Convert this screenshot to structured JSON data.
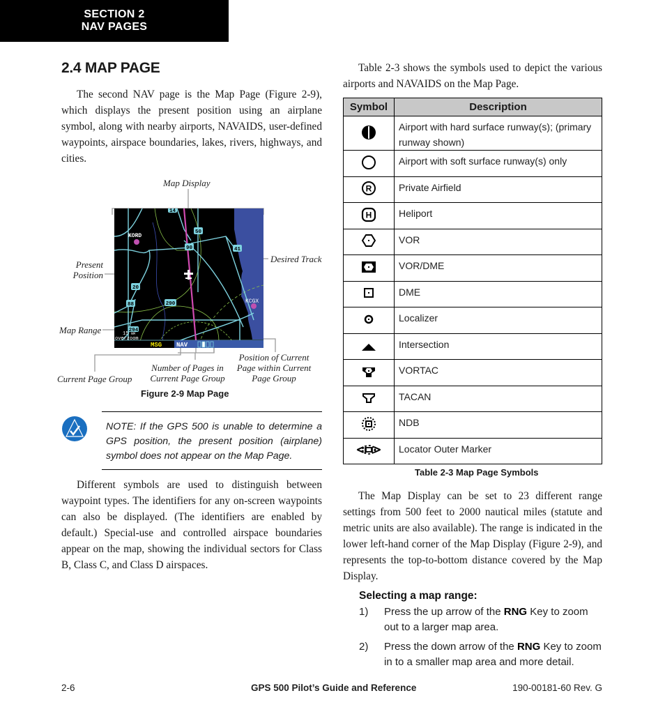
{
  "header": {
    "section_line1": "SECTION 2",
    "section_line2": "NAV PAGES"
  },
  "heading": "2.4  MAP PAGE",
  "left_column": {
    "intro": "The second NAV page is the Map Page (Figure 2-9), which displays the present position using an airplane symbol, along with nearby airports, NAVAIDS, user-defined waypoints, airspace boundaries, lakes, rivers, highways, and cities.",
    "figure": {
      "caption": "Figure 2-9  Map Page",
      "callouts": {
        "map_display": "Map Display",
        "desired_track": "Desired Track",
        "present_position_1": "Present",
        "present_position_2": "Position",
        "map_range": "Map Range",
        "current_page_group": "Current Page Group",
        "num_pages_1": "Number of Pages in",
        "num_pages_2": "Current Page Group",
        "position_current_1": "Position of Current",
        "position_current_2": "Page within Current",
        "position_current_3": "Page Group"
      },
      "screen": {
        "airports": [
          "KORD",
          "KCGX"
        ],
        "highway_shields": [
          "14",
          "50",
          "90",
          "41",
          "20",
          "88",
          "290",
          "294"
        ],
        "range_value": "15",
        "range_unit": "NM",
        "range_mode": "overzoom",
        "page_group_msg": "MSG",
        "page_group_nav": "NAV",
        "nav_pages_total": 4,
        "nav_current_page": 2,
        "colors": {
          "water": "#3b4fa0",
          "roads": "#7ed3e0",
          "airspace": "#8bc34a",
          "track": "#d04ab0",
          "msg": "#f2e600",
          "status_bar": "#3a5aa8"
        }
      }
    },
    "note": "NOTE:  If the GPS 500 is unable to determine a GPS position, the present position (airplane) symbol does not appear on the Map Page.",
    "para2": "Different symbols are used to distinguish between waypoint types.  The identifiers for any on-screen waypoints can also be displayed.  (The identifiers are enabled by default.)  Special-use and controlled airspace boundaries appear on the map, showing the individual sectors for Class B, Class C, and Class D airspaces."
  },
  "right_column": {
    "intro": "Table 2-3 shows the symbols used to depict the various airports and NAVAIDS on the Map Page.",
    "table": {
      "headers": [
        "Symbol",
        "Description"
      ],
      "rows": [
        {
          "icon": "airport-hard-runway-icon",
          "desc": "Airport with hard surface runway(s); (primary runway shown)"
        },
        {
          "icon": "airport-soft-runway-icon",
          "desc": "Airport with soft surface runway(s) only"
        },
        {
          "icon": "private-airfield-icon",
          "desc": "Private Airfield"
        },
        {
          "icon": "heliport-icon",
          "desc": "Heliport"
        },
        {
          "icon": "vor-icon",
          "desc": "VOR"
        },
        {
          "icon": "vor-dme-icon",
          "desc": "VOR/DME"
        },
        {
          "icon": "dme-icon",
          "desc": "DME"
        },
        {
          "icon": "localizer-icon",
          "desc": "Localizer"
        },
        {
          "icon": "intersection-icon",
          "desc": "Intersection"
        },
        {
          "icon": "vortac-icon",
          "desc": "VORTAC"
        },
        {
          "icon": "tacan-icon",
          "desc": "TACAN"
        },
        {
          "icon": "ndb-icon",
          "desc": "NDB"
        },
        {
          "icon": "locator-outer-marker-icon",
          "desc": "Locator Outer Marker"
        }
      ],
      "caption": "Table 2-3 Map Page Symbols"
    },
    "para2": "The Map Display can be set to 23 different range settings from 500 feet to 2000 nautical miles (statute and metric units are also available).  The range is indicated in the lower left-hand corner of the Map Display (Figure 2-9), and represents the top-to-bottom distance covered by the Map Display.",
    "procedure": {
      "title": "Selecting a map range:",
      "steps": [
        {
          "num": "1)",
          "pre": "Press the up arrow of the ",
          "key": "RNG",
          "post": " Key to zoom out to a larger map area."
        },
        {
          "num": "2)",
          "pre": "Press the down arrow of the ",
          "key": "RNG",
          "post": " Key to zoom in to a smaller map area and more detail."
        }
      ]
    }
  },
  "footer": {
    "page_number": "2-6",
    "title": "GPS 500 Pilot’s Guide and Reference",
    "doc_number": "190-00181-60  Rev. G"
  }
}
